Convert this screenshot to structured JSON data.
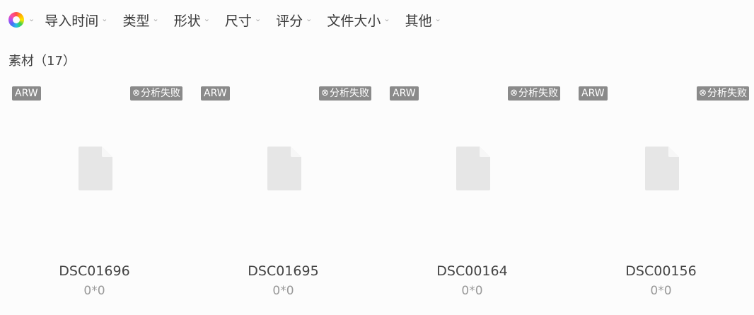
{
  "filters": {
    "color_icon": "color-wheel-icon",
    "items": [
      {
        "label": "导入时间"
      },
      {
        "label": "类型"
      },
      {
        "label": "形状"
      },
      {
        "label": "尺寸"
      },
      {
        "label": "评分"
      },
      {
        "label": "文件大小"
      },
      {
        "label": "其他"
      }
    ]
  },
  "section": {
    "title": "素材（17）"
  },
  "cards": [
    {
      "format": "ARW",
      "status": "分析失败",
      "name": "DSC01696",
      "dims": "0*0"
    },
    {
      "format": "ARW",
      "status": "分析失败",
      "name": "DSC01695",
      "dims": "0*0"
    },
    {
      "format": "ARW",
      "status": "分析失败",
      "name": "DSC00164",
      "dims": "0*0"
    },
    {
      "format": "ARW",
      "status": "分析失败",
      "name": "DSC00156",
      "dims": "0*0"
    }
  ],
  "colors": {
    "background": "#fcfcfc",
    "badge": "#8a8a8a",
    "file_icon": "#e6e6e6"
  }
}
